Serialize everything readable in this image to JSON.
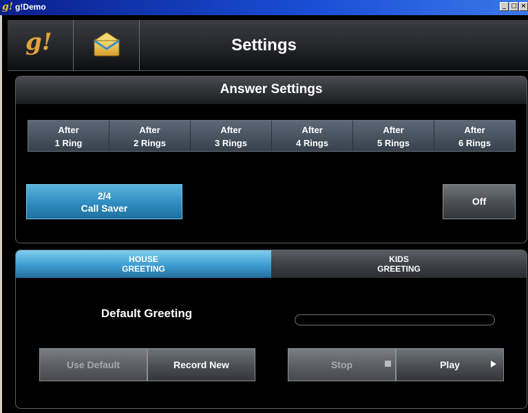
{
  "window": {
    "title": "g!Demo",
    "icon": "g-logo-icon",
    "controls": [
      "minimize",
      "maximize",
      "close"
    ]
  },
  "header": {
    "logo": "g!",
    "mail_icon": "envelope-icon",
    "title": "Settings"
  },
  "answer_settings": {
    "title": "Answer Settings",
    "rings": [
      {
        "top": "After",
        "bottom": "1 Ring"
      },
      {
        "top": "After",
        "bottom": "2 Rings"
      },
      {
        "top": "After",
        "bottom": "3 Rings"
      },
      {
        "top": "After",
        "bottom": "4 Rings"
      },
      {
        "top": "After",
        "bottom": "5 Rings"
      },
      {
        "top": "After",
        "bottom": "6 Rings"
      }
    ],
    "call_saver": {
      "value": "2/4",
      "label": "Call Saver"
    },
    "off_label": "Off"
  },
  "greeting": {
    "tabs": [
      {
        "line1": "HOUSE",
        "line2": "GREETING",
        "active": true
      },
      {
        "line1": "KIDS",
        "line2": "GREETING",
        "active": false
      }
    ],
    "default_label": "Default Greeting",
    "use_default_label": "Use Default",
    "record_new_label": "Record New",
    "stop_label": "Stop",
    "play_label": "Play"
  },
  "colors": {
    "accent_blue": "#3c9ccf",
    "logo_gold": "#e3a23a"
  }
}
